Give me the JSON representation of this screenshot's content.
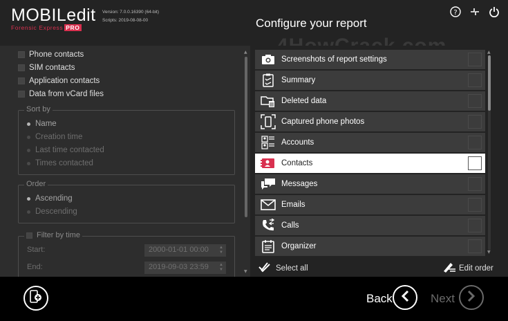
{
  "header": {
    "logo_main": "MOBILedit",
    "logo_sub": "Forensic Express",
    "logo_pro": "PRO",
    "version": "Version: 7.0.0.16390 (64-bit)",
    "scripts": "Scripts: 2019-08-08-00",
    "title": "Configure your report",
    "watermark": "4HowCrack.com",
    "icons": [
      "help-icon",
      "minimize-icon",
      "power-icon"
    ]
  },
  "left_panel": {
    "sources": [
      {
        "label": "Phone contacts",
        "checked": false
      },
      {
        "label": "SIM contacts",
        "checked": false
      },
      {
        "label": "Application contacts",
        "checked": false
      },
      {
        "label": "Data from vCard files",
        "checked": false
      }
    ],
    "sort_by": {
      "legend": "Sort by",
      "options": [
        "Name",
        "Creation time",
        "Last time contacted",
        "Times contacted"
      ],
      "selected": "Name"
    },
    "order": {
      "legend": "Order",
      "options": [
        "Ascending",
        "Descending"
      ],
      "selected": "Ascending"
    },
    "filter": {
      "legend": "Filter by time",
      "start_label": "Start:",
      "start_value": "2000-01-01 00:00",
      "end_label": "End:",
      "end_value": "2019-09-03 23:59"
    }
  },
  "sections": [
    {
      "label": "Screenshots of report settings",
      "icon": "camera-icon",
      "selected": false
    },
    {
      "label": "Summary",
      "icon": "summary-icon",
      "selected": false
    },
    {
      "label": "Deleted data",
      "icon": "deleted-data-icon",
      "selected": false
    },
    {
      "label": "Captured phone photos",
      "icon": "phone-photo-icon",
      "selected": false
    },
    {
      "label": "Accounts",
      "icon": "accounts-icon",
      "selected": false
    },
    {
      "label": "Contacts",
      "icon": "contacts-icon",
      "selected": true
    },
    {
      "label": "Messages",
      "icon": "messages-icon",
      "selected": false
    },
    {
      "label": "Emails",
      "icon": "emails-icon",
      "selected": false
    },
    {
      "label": "Calls",
      "icon": "calls-icon",
      "selected": false
    },
    {
      "label": "Organizer",
      "icon": "organizer-icon",
      "selected": false
    }
  ],
  "actions": {
    "select_all": "Select all",
    "edit_order": "Edit order"
  },
  "footer": {
    "back": "Back",
    "next": "Next"
  },
  "colors": {
    "accent_red": "#d9304f",
    "panel": "#2d2d2d",
    "item": "#3c3c3c"
  }
}
